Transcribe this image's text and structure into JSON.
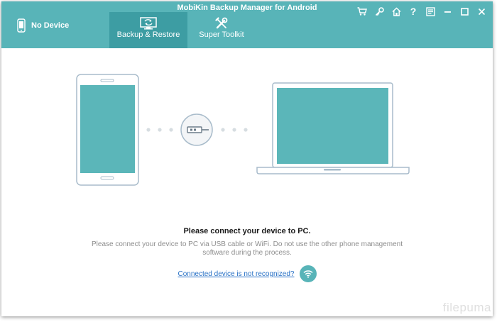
{
  "app": {
    "title": "MobiKin Backup Manager for Android"
  },
  "device": {
    "status": "No Device",
    "icon": "phone-icon"
  },
  "tabs": [
    {
      "label": "Backup & Restore",
      "icon": "backup-restore-icon",
      "active": true
    },
    {
      "label": "Super Toolkit",
      "icon": "tools-icon",
      "active": false
    }
  ],
  "toolbar": {
    "icons": [
      "cart-icon",
      "key-icon",
      "home-icon",
      "help-icon",
      "feedback-icon",
      "minimize-icon",
      "maximize-icon",
      "close-icon"
    ],
    "help_glyph": "?"
  },
  "main": {
    "illustration_icons": [
      "phone-icon",
      "usb-cable-icon",
      "laptop-icon"
    ],
    "title": "Please connect your device to PC.",
    "description": "Please connect your device to PC via USB cable or WiFi. Do not use the other phone management software during the process.",
    "link": "Connected device is not recognized?",
    "link_icon": "wifi-icon"
  },
  "watermark": "filepuma",
  "colors": {
    "header": "#58b4b8",
    "active_tab": "#3d9da3",
    "screen": "#5bb6b9",
    "outline": "#a9bccb",
    "link": "#2a72c6"
  }
}
